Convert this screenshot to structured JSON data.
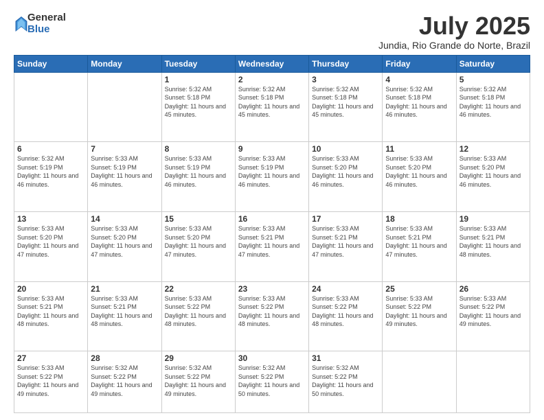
{
  "logo": {
    "general": "General",
    "blue": "Blue"
  },
  "header": {
    "month": "July 2025",
    "location": "Jundia, Rio Grande do Norte, Brazil"
  },
  "weekdays": [
    "Sunday",
    "Monday",
    "Tuesday",
    "Wednesday",
    "Thursday",
    "Friday",
    "Saturday"
  ],
  "weeks": [
    [
      {
        "day": "",
        "text": ""
      },
      {
        "day": "",
        "text": ""
      },
      {
        "day": "1",
        "text": "Sunrise: 5:32 AM\nSunset: 5:18 PM\nDaylight: 11 hours and 45 minutes."
      },
      {
        "day": "2",
        "text": "Sunrise: 5:32 AM\nSunset: 5:18 PM\nDaylight: 11 hours and 45 minutes."
      },
      {
        "day": "3",
        "text": "Sunrise: 5:32 AM\nSunset: 5:18 PM\nDaylight: 11 hours and 45 minutes."
      },
      {
        "day": "4",
        "text": "Sunrise: 5:32 AM\nSunset: 5:18 PM\nDaylight: 11 hours and 46 minutes."
      },
      {
        "day": "5",
        "text": "Sunrise: 5:32 AM\nSunset: 5:18 PM\nDaylight: 11 hours and 46 minutes."
      }
    ],
    [
      {
        "day": "6",
        "text": "Sunrise: 5:32 AM\nSunset: 5:19 PM\nDaylight: 11 hours and 46 minutes."
      },
      {
        "day": "7",
        "text": "Sunrise: 5:33 AM\nSunset: 5:19 PM\nDaylight: 11 hours and 46 minutes."
      },
      {
        "day": "8",
        "text": "Sunrise: 5:33 AM\nSunset: 5:19 PM\nDaylight: 11 hours and 46 minutes."
      },
      {
        "day": "9",
        "text": "Sunrise: 5:33 AM\nSunset: 5:19 PM\nDaylight: 11 hours and 46 minutes."
      },
      {
        "day": "10",
        "text": "Sunrise: 5:33 AM\nSunset: 5:20 PM\nDaylight: 11 hours and 46 minutes."
      },
      {
        "day": "11",
        "text": "Sunrise: 5:33 AM\nSunset: 5:20 PM\nDaylight: 11 hours and 46 minutes."
      },
      {
        "day": "12",
        "text": "Sunrise: 5:33 AM\nSunset: 5:20 PM\nDaylight: 11 hours and 46 minutes."
      }
    ],
    [
      {
        "day": "13",
        "text": "Sunrise: 5:33 AM\nSunset: 5:20 PM\nDaylight: 11 hours and 47 minutes."
      },
      {
        "day": "14",
        "text": "Sunrise: 5:33 AM\nSunset: 5:20 PM\nDaylight: 11 hours and 47 minutes."
      },
      {
        "day": "15",
        "text": "Sunrise: 5:33 AM\nSunset: 5:20 PM\nDaylight: 11 hours and 47 minutes."
      },
      {
        "day": "16",
        "text": "Sunrise: 5:33 AM\nSunset: 5:21 PM\nDaylight: 11 hours and 47 minutes."
      },
      {
        "day": "17",
        "text": "Sunrise: 5:33 AM\nSunset: 5:21 PM\nDaylight: 11 hours and 47 minutes."
      },
      {
        "day": "18",
        "text": "Sunrise: 5:33 AM\nSunset: 5:21 PM\nDaylight: 11 hours and 47 minutes."
      },
      {
        "day": "19",
        "text": "Sunrise: 5:33 AM\nSunset: 5:21 PM\nDaylight: 11 hours and 48 minutes."
      }
    ],
    [
      {
        "day": "20",
        "text": "Sunrise: 5:33 AM\nSunset: 5:21 PM\nDaylight: 11 hours and 48 minutes."
      },
      {
        "day": "21",
        "text": "Sunrise: 5:33 AM\nSunset: 5:21 PM\nDaylight: 11 hours and 48 minutes."
      },
      {
        "day": "22",
        "text": "Sunrise: 5:33 AM\nSunset: 5:22 PM\nDaylight: 11 hours and 48 minutes."
      },
      {
        "day": "23",
        "text": "Sunrise: 5:33 AM\nSunset: 5:22 PM\nDaylight: 11 hours and 48 minutes."
      },
      {
        "day": "24",
        "text": "Sunrise: 5:33 AM\nSunset: 5:22 PM\nDaylight: 11 hours and 48 minutes."
      },
      {
        "day": "25",
        "text": "Sunrise: 5:33 AM\nSunset: 5:22 PM\nDaylight: 11 hours and 49 minutes."
      },
      {
        "day": "26",
        "text": "Sunrise: 5:33 AM\nSunset: 5:22 PM\nDaylight: 11 hours and 49 minutes."
      }
    ],
    [
      {
        "day": "27",
        "text": "Sunrise: 5:33 AM\nSunset: 5:22 PM\nDaylight: 11 hours and 49 minutes."
      },
      {
        "day": "28",
        "text": "Sunrise: 5:32 AM\nSunset: 5:22 PM\nDaylight: 11 hours and 49 minutes."
      },
      {
        "day": "29",
        "text": "Sunrise: 5:32 AM\nSunset: 5:22 PM\nDaylight: 11 hours and 49 minutes."
      },
      {
        "day": "30",
        "text": "Sunrise: 5:32 AM\nSunset: 5:22 PM\nDaylight: 11 hours and 50 minutes."
      },
      {
        "day": "31",
        "text": "Sunrise: 5:32 AM\nSunset: 5:22 PM\nDaylight: 11 hours and 50 minutes."
      },
      {
        "day": "",
        "text": ""
      },
      {
        "day": "",
        "text": ""
      }
    ]
  ]
}
